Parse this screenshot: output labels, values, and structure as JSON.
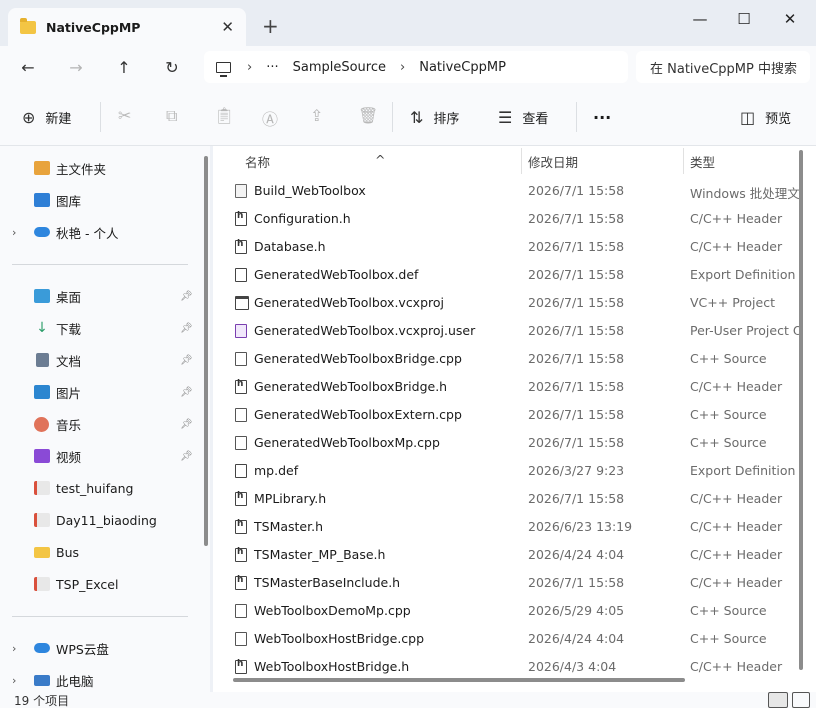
{
  "window": {
    "tab_title": "NativeCppMP",
    "close_tab": "✕",
    "new_tab": "+",
    "minimize": "—",
    "maximize": "☐",
    "close": "✕"
  },
  "address": {
    "ellipsis": "···",
    "crumbs": [
      "SampleSource",
      "NativeCppMP"
    ],
    "separator": "›"
  },
  "search": {
    "placeholder": "在 NativeCppMP 中搜索"
  },
  "toolbar": {
    "new_label": "新建",
    "sort_label": "排序",
    "view_label": "查看",
    "more_label": "···",
    "preview_label": "预览"
  },
  "sidebar": {
    "items": [
      {
        "label": "主文件夹",
        "icon": "home-icon",
        "color": "#e8a33c"
      },
      {
        "label": "图库",
        "icon": "gallery-icon",
        "color": "#2f7fd6"
      },
      {
        "label": "秋艳 - 个人",
        "icon": "onedrive-icon",
        "color": "#2e86de"
      },
      {
        "label": "桌面",
        "icon": "desktop-icon",
        "color": "#3a9bd9",
        "pinned": true
      },
      {
        "label": "下载",
        "icon": "download-icon",
        "color": "#2d9e6b",
        "pinned": true
      },
      {
        "label": "文档",
        "icon": "documents-icon",
        "color": "#6c7d93",
        "pinned": true
      },
      {
        "label": "图片",
        "icon": "pictures-icon",
        "color": "#2c86d0",
        "pinned": true
      },
      {
        "label": "音乐",
        "icon": "music-icon",
        "color": "#e0735a",
        "pinned": true
      },
      {
        "label": "视频",
        "icon": "videos-icon",
        "color": "#8a4ad6",
        "pinned": true
      },
      {
        "label": "test_huifang",
        "icon": "tsmaster-folder-icon",
        "color": "#d9503c"
      },
      {
        "label": "Day11_biaoding",
        "icon": "tsmaster-folder-icon",
        "color": "#d9503c"
      },
      {
        "label": "Bus",
        "icon": "folder-icon",
        "color": "#f3c544"
      },
      {
        "label": "TSP_Excel",
        "icon": "tsmaster-folder-icon",
        "color": "#d9503c"
      },
      {
        "label": "WPS云盘",
        "icon": "cloud-icon",
        "color": "#2e86de"
      },
      {
        "label": "此电脑",
        "icon": "computer-icon",
        "color": "#3a7bc8"
      }
    ]
  },
  "columns": {
    "name": "名称",
    "date": "修改日期",
    "type": "类型"
  },
  "files": [
    {
      "name": "Build_WebToolbox",
      "date": "2026/7/1 15:58",
      "type": "Windows 批处理文件",
      "icon": "bat"
    },
    {
      "name": "Configuration.h",
      "date": "2026/7/1 15:58",
      "type": "C/C++ Header",
      "icon": "h"
    },
    {
      "name": "Database.h",
      "date": "2026/7/1 15:58",
      "type": "C/C++ Header",
      "icon": "h"
    },
    {
      "name": "GeneratedWebToolbox.def",
      "date": "2026/7/1 15:58",
      "type": "Export Definition F",
      "icon": "def"
    },
    {
      "name": "GeneratedWebToolbox.vcxproj",
      "date": "2026/7/1 15:58",
      "type": "VC++ Project",
      "icon": "proj"
    },
    {
      "name": "GeneratedWebToolbox.vcxproj.user",
      "date": "2026/7/1 15:58",
      "type": "Per-User Project O",
      "icon": "user"
    },
    {
      "name": "GeneratedWebToolboxBridge.cpp",
      "date": "2026/7/1 15:58",
      "type": "C++ Source",
      "icon": "c"
    },
    {
      "name": "GeneratedWebToolboxBridge.h",
      "date": "2026/7/1 15:58",
      "type": "C/C++ Header",
      "icon": "h"
    },
    {
      "name": "GeneratedWebToolboxExtern.cpp",
      "date": "2026/7/1 15:58",
      "type": "C++ Source",
      "icon": "c"
    },
    {
      "name": "GeneratedWebToolboxMp.cpp",
      "date": "2026/7/1 15:58",
      "type": "C++ Source",
      "icon": "c"
    },
    {
      "name": "mp.def",
      "date": "2026/3/27 9:23",
      "type": "Export Definition F",
      "icon": "def"
    },
    {
      "name": "MPLibrary.h",
      "date": "2026/7/1 15:58",
      "type": "C/C++ Header",
      "icon": "h"
    },
    {
      "name": "TSMaster.h",
      "date": "2026/6/23 13:19",
      "type": "C/C++ Header",
      "icon": "h"
    },
    {
      "name": "TSMaster_MP_Base.h",
      "date": "2026/4/24 4:04",
      "type": "C/C++ Header",
      "icon": "h"
    },
    {
      "name": "TSMasterBaseInclude.h",
      "date": "2026/7/1 15:58",
      "type": "C/C++ Header",
      "icon": "h"
    },
    {
      "name": "WebToolboxDemoMp.cpp",
      "date": "2026/5/29 4:05",
      "type": "C++ Source",
      "icon": "c"
    },
    {
      "name": "WebToolboxHostBridge.cpp",
      "date": "2026/4/24 4:04",
      "type": "C++ Source",
      "icon": "c"
    },
    {
      "name": "WebToolboxHostBridge.h",
      "date": "2026/4/3 4:04",
      "type": "C/C++ Header",
      "icon": "h"
    }
  ],
  "status": {
    "item_count": "19 个项目"
  }
}
